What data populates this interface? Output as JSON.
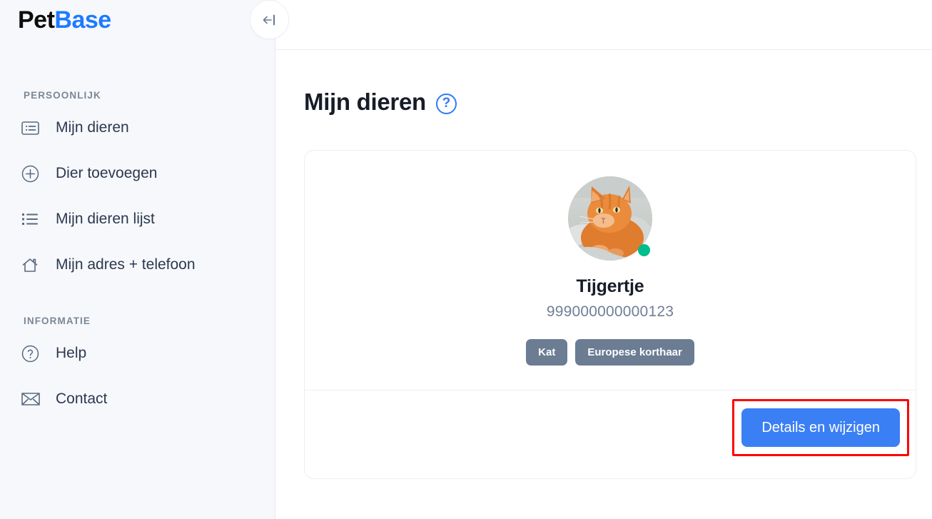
{
  "brand": {
    "name_part_1": "Pet",
    "name_part_2": "B",
    "name_part_3": "ase",
    "accent_color": "#1d7bff"
  },
  "sidebar": {
    "sections": [
      {
        "label": "PERSOONLIJK",
        "items": [
          {
            "label": "Mijn dieren",
            "icon": "address-card-icon"
          },
          {
            "label": "Dier toevoegen",
            "icon": "plus-circle-icon"
          },
          {
            "label": "Mijn dieren lijst",
            "icon": "list-icon"
          },
          {
            "label": "Mijn adres + telefoon",
            "icon": "home-icon"
          }
        ]
      },
      {
        "label": "INFORMATIE",
        "items": [
          {
            "label": "Help",
            "icon": "question-circle-icon"
          },
          {
            "label": "Contact",
            "icon": "envelope-icon"
          }
        ]
      }
    ]
  },
  "topbar": {
    "collapse_icon": "collapse-sidebar-icon"
  },
  "main": {
    "page_title": "Mijn dieren",
    "help_icon_label": "?",
    "pet_card": {
      "avatar_alt": "ginger cat photo",
      "status": "online",
      "status_color": "#00bd8c",
      "name": "Tijgertje",
      "chip_number": "999000000000123",
      "tags": [
        "Kat",
        "Europese korthaar"
      ],
      "action_button": {
        "label": "Details en wijzigen",
        "color": "#3b7ff5",
        "highlighted": true,
        "highlight_color": "#ff0000"
      }
    }
  }
}
